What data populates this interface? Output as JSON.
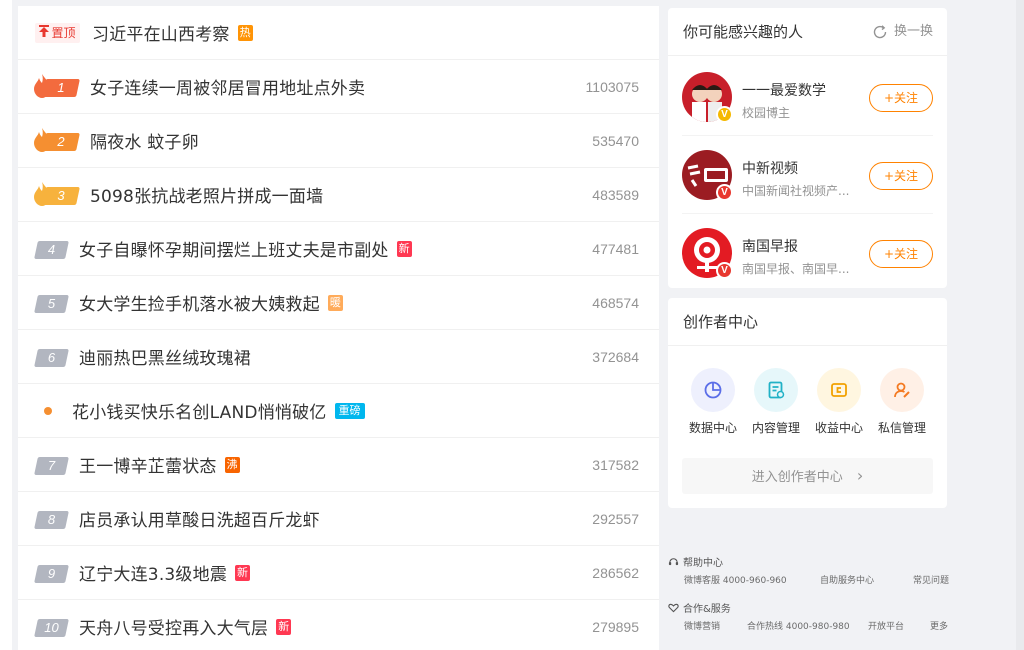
{
  "hot_list": {
    "pinned": {
      "tag": "置顶",
      "title": "习近平在山西考察",
      "badge": "热"
    },
    "items": [
      {
        "rank": "1",
        "title": "女子连续一周被邻居冒用地址点外卖",
        "count": "1103075",
        "badge": ""
      },
      {
        "rank": "2",
        "title": "隔夜水 蚊子卵",
        "count": "535470",
        "badge": ""
      },
      {
        "rank": "3",
        "title": "5098张抗战老照片拼成一面墙",
        "count": "483589",
        "badge": ""
      },
      {
        "rank": "4",
        "title": "女子自曝怀孕期间摆烂上班丈夫是市副处",
        "count": "477481",
        "badge": "新"
      },
      {
        "rank": "5",
        "title": "女大学生捡手机落水被大姨救起",
        "count": "468574",
        "badge": "暖"
      },
      {
        "rank": "6",
        "title": "迪丽热巴黑丝绒玫瑰裙",
        "count": "372684",
        "badge": ""
      },
      {
        "rank": "",
        "title": "花小钱买快乐名创LAND悄悄破亿",
        "count": "",
        "badge": "重磅"
      },
      {
        "rank": "7",
        "title": "王一博辛芷蕾状态",
        "count": "317582",
        "badge": "沸"
      },
      {
        "rank": "8",
        "title": "店员承认用草酸日洗超百斤龙虾",
        "count": "292557",
        "badge": ""
      },
      {
        "rank": "9",
        "title": "辽宁大连3.3级地震",
        "count": "286562",
        "badge": "新"
      },
      {
        "rank": "10",
        "title": "天舟八号受控再入大气层",
        "count": "279895",
        "badge": "新"
      }
    ]
  },
  "recommend": {
    "title": "你可能感兴趣的人",
    "refresh_label": "换一换",
    "people": [
      {
        "name": "一一最爱数学",
        "desc": "校园博主",
        "follow": "+关注"
      },
      {
        "name": "中新视频",
        "desc": "中国新闻社视频产...",
        "follow": "+关注"
      },
      {
        "name": "南国早报",
        "desc": "南国早报、南国早...",
        "follow": "+关注"
      }
    ]
  },
  "creator": {
    "title": "创作者中心",
    "tools": [
      {
        "label": "数据中心"
      },
      {
        "label": "内容管理"
      },
      {
        "label": "收益中心"
      },
      {
        "label": "私信管理"
      }
    ],
    "enter_label": "进入创作者中心",
    "enter_arrow": "›"
  },
  "footer": {
    "help_title": "帮助中心",
    "help_links": [
      "微博客服 4000-960-960",
      "自助服务中心",
      "常见问题"
    ],
    "coop_title": "合作&服务",
    "coop_links": [
      "微博营销",
      "合作热线 4000-980-980",
      "开放平台",
      "更多"
    ]
  },
  "colors": {
    "accent": "#ff8200",
    "hot_red": "#e8382f",
    "rank1": "#f36b3e",
    "rank2": "#f58f31",
    "rank3": "#f7b23d",
    "rank_plain": "#b2b6c0",
    "muted": "#939393"
  },
  "icons": {
    "pin": "pin-arrow-icon",
    "rank_top": "flame-icon",
    "refresh": "refresh-icon",
    "verified": "verified-v-icon",
    "tools": [
      "pie-chart-icon",
      "document-icon",
      "wallet-icon",
      "person-edit-icon"
    ],
    "help": "headset-icon",
    "coop": "handshake-icon"
  }
}
